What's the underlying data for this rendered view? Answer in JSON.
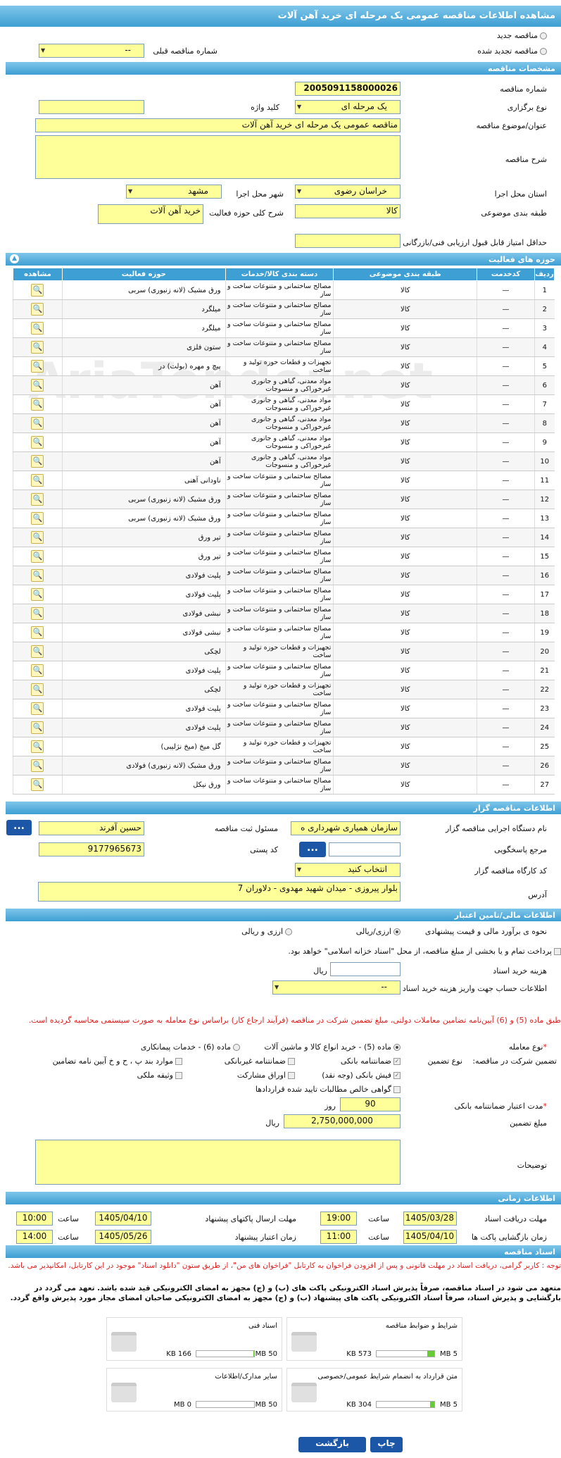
{
  "title": "مشاهده اطلاعات مناقصه عمومی یک مرحله ای خرید آهن آلات",
  "new_label": "مناقصه جدید",
  "renew_label": "مناقصه تجدید شده",
  "prev_label": "شماره مناقصه قبلی",
  "prev_value": "--",
  "sec_spec": "مشخصات مناقصه",
  "num_label": "شماره مناقصه",
  "num_value": "2005091158000026",
  "type_label": "نوع برگزاری",
  "type_value": "یک مرحله ای",
  "kw_label": "کلید واژه",
  "subj_label": "عنوان/موضوع مناقصه",
  "subj_value": "مناقصه عمومی یک مرحله ای خرید آهن آلات",
  "desc_label": "شرح مناقصه",
  "prov_label": "استان محل اجرا",
  "prov_value": "خراسان رضوی",
  "city_label": "شهر محل اجرا",
  "city_value": "مشهد",
  "cat_label": "طبقه بندی موضوعی",
  "cat_value": "کالا",
  "scope_label": "شرح کلی حوزه فعالیت",
  "scope_value": "خرید آهن آلات",
  "min_label": "حداقل امتیاز قابل قبول ارزیابی فنی/بازرگانی",
  "sec_fields": "حوزه های فعالیت",
  "cols": [
    "ردیف",
    "کدخدمت",
    "طبقه بندی موضوعی",
    "دسته بندی کالا/خدمات",
    "حوزه فعالیت",
    "مشاهده"
  ],
  "rows": [
    [
      "1",
      "—",
      "کالا",
      "مصالح ساختمانی و متنوعات ساخت و ساز",
      "ورق مشبک (لانه زنبوری) سربی"
    ],
    [
      "2",
      "—",
      "کالا",
      "مصالح ساختمانی و متنوعات ساخت و ساز",
      "میلگرد"
    ],
    [
      "3",
      "—",
      "کالا",
      "مصالح ساختمانی و متنوعات ساخت و ساز",
      "میلگرد"
    ],
    [
      "4",
      "—",
      "کالا",
      "مصالح ساختمانی و متنوعات ساخت و ساز",
      "ستون فلزی"
    ],
    [
      "5",
      "—",
      "کالا",
      "تجهیزات و قطعات حوزه تولید و ساخت",
      "پیچ و مهره (بولت) در"
    ],
    [
      "6",
      "—",
      "کالا",
      "مواد معدنی، گیاهی و جانوری غیرخوراکی و منسوجات",
      "آهن"
    ],
    [
      "7",
      "—",
      "کالا",
      "مواد معدنی، گیاهی و جانوری غیرخوراکی و منسوجات",
      "آهن"
    ],
    [
      "8",
      "—",
      "کالا",
      "مواد معدنی، گیاهی و جانوری غیرخوراکی و منسوجات",
      "آهن"
    ],
    [
      "9",
      "—",
      "کالا",
      "مواد معدنی، گیاهی و جانوری غیرخوراکی و منسوجات",
      "آهن"
    ],
    [
      "10",
      "—",
      "کالا",
      "مواد معدنی، گیاهی و جانوری غیرخوراکی و منسوجات",
      "آهن"
    ],
    [
      "11",
      "—",
      "کالا",
      "مصالح ساختمانی و متنوعات ساخت و ساز",
      "ناودانی آهنی"
    ],
    [
      "12",
      "—",
      "کالا",
      "مصالح ساختمانی و متنوعات ساخت و ساز",
      "ورق مشبک (لانه زنبوری) سربی"
    ],
    [
      "13",
      "—",
      "کالا",
      "مصالح ساختمانی و متنوعات ساخت و ساز",
      "ورق مشبک (لانه زنبوری) سربی"
    ],
    [
      "14",
      "—",
      "کالا",
      "مصالح ساختمانی و متنوعات ساخت و ساز",
      "تیر ورق"
    ],
    [
      "15",
      "—",
      "کالا",
      "مصالح ساختمانی و متنوعات ساخت و ساز",
      "تیر ورق"
    ],
    [
      "16",
      "—",
      "کالا",
      "مصالح ساختمانی و متنوعات ساخت و ساز",
      "پلیت فولادی"
    ],
    [
      "17",
      "—",
      "کالا",
      "مصالح ساختمانی و متنوعات ساخت و ساز",
      "پلیت فولادی"
    ],
    [
      "18",
      "—",
      "کالا",
      "مصالح ساختمانی و متنوعات ساخت و ساز",
      "نبشی فولادی"
    ],
    [
      "19",
      "—",
      "کالا",
      "مصالح ساختمانی و متنوعات ساخت و ساز",
      "نبشی فولادی"
    ],
    [
      "20",
      "—",
      "کالا",
      "تجهیزات و قطعات حوزه تولید و ساخت",
      "لچکی"
    ],
    [
      "21",
      "—",
      "کالا",
      "مصالح ساختمانی و متنوعات ساخت و ساز",
      "پلیت فولادی"
    ],
    [
      "22",
      "—",
      "کالا",
      "تجهیزات و قطعات حوزه تولید و ساخت",
      "لچکی"
    ],
    [
      "23",
      "—",
      "کالا",
      "مصالح ساختمانی و متنوعات ساخت و ساز",
      "پلیت فولادی"
    ],
    [
      "24",
      "—",
      "کالا",
      "مصالح ساختمانی و متنوعات ساخت و ساز",
      "پلیت فولادی"
    ],
    [
      "25",
      "—",
      "کالا",
      "تجهیزات و قطعات حوزه تولید و ساخت",
      "گل میخ (میخ نژلیبی)"
    ],
    [
      "26",
      "—",
      "کالا",
      "مصالح ساختمانی و متنوعات ساخت و ساز",
      "ورق مشبک (لانه زنبوری) فولادی"
    ],
    [
      "27",
      "—",
      "کالا",
      "مصالح ساختمانی و متنوعات ساخت و ساز",
      "ورق نیکل"
    ]
  ],
  "sec_org": "اطلاعات مناقصه گزار",
  "org_label": "نام دستگاه اجرایی مناقصه گزار",
  "org_value": "سازمان همیاری شهرداری ه",
  "resp_label": "مسئول ثبت مناقصه",
  "resp_value": "حسین آفرند",
  "ref_label": "مرجع پاسخگویی",
  "postal_label": "کد پستی",
  "postal_value": "9177965673",
  "ws_label": "کد کارگاه مناقصه گزار",
  "ws_value": "انتخاب کنید",
  "addr_label": "آدرس",
  "addr_value": "بلوار پیروزی - میدان شهید مهدوی - دلاوران 7",
  "btn_dots": "...",
  "sec_fin": "اطلاعات مالی/تامین اعتبار",
  "est_label": "نحوه ی برآورد مالی و قیمت پیشنهادی",
  "est_opt1": "ارزی/ریالی",
  "est_opt2": "ارزی و ریالی",
  "pay_label": "پرداخت تمام و یا بخشی از مبلغ مناقصه، از محل \"اسناد خزانه اسلامی\" خواهد بود.",
  "cost_label": "هزینه خرید اسناد",
  "cost_unit": "ریال",
  "acc_label": "اطلاعات حساب جهت واریز هزینه خرید اسناد",
  "acc_value": "--",
  "law_note": "طبق ماده (5) و (6) آیین‌نامه تضامین معاملات دولتی، مبلغ تضمین شرکت در مناقصه (فرآیند ارجاع کار) براساس نوع معامله به صورت سیستمی محاسبه گردیده است.",
  "deal_label": "نوع معامله",
  "deal_opt1": "ماده (5) - خرید انواع کالا و ماشین آلات",
  "deal_opt2": "ماده (6) - خدمات پیمانکاری",
  "guar_label": "تضمین شرکت در مناقصه:",
  "guar_type": "نوع تضمین",
  "g1": "ضمانتنامه بانکی",
  "g2": "ضمانتنامه غیربانکی",
  "g3": "موارد بند پ ، ح و خ آیین نامه تضامین",
  "g4": "فیش بانکی (وجه نقد)",
  "g5": "اوراق مشارکت",
  "g6": "وثیقه ملکی",
  "g7": "گواهی خالص مطالبات تایید شده قراردادها",
  "valid_label": "مدت اعتبار ضمانتنامه بانکی",
  "valid_value": "90",
  "valid_unit": "روز",
  "amount_label": "مبلغ تضمین",
  "amount_value": "2,750,000,000",
  "amount_unit": "ریال",
  "notes_label": "توضیحات",
  "sec_time": "اطلاعات زمانی",
  "t1_label": "مهلت دریافت اسناد",
  "t1_date": "1405/03/28",
  "t1_time": "19:00",
  "t2_label": "مهلت ارسال پاکتهای پیشنهاد",
  "t2_date": "1405/04/10",
  "t2_time": "10:00",
  "t3_label": "زمان بازگشایی پاکت ها",
  "t3_date": "1405/04/10",
  "t3_time": "11:00",
  "t4_label": "زمان اعتبار پیشنهاد",
  "t4_date": "1405/05/26",
  "t4_time": "14:00",
  "time_word": "ساعت",
  "sec_docs": "اسناد مناقصه",
  "docs_note1": "توجه : کاربر گرامی، دریافت اسناد در مهلت قانونی و پس از افزودن فراخوان به کارتابل \"فراخوان های من\"، از طریق ستون \"دانلود اسناد\" موجود در این کارتابل، امکانپذیر می باشد.",
  "docs_note2": "متعهد می شود در اسناد مناقصه، صرفاً پذیرش اسناد الکترونیکی پاکت های (ب) و (ج) مجهز به امضای الکترونیکی قید شده باشد. تعهد می گردد در بارگشایی و پذیرش اسناد، صرفاً اسناد الکترونیکی پاکت های پیشنهاد (ب) و (ج) مجهز به امضای الکترونیکی صاحبان امضای مجاز مورد پذیرش واقع گردد.",
  "d1": "شرایط و ضوابط مناقصه",
  "d1a": "573 KB",
  "d1b": "5 MB",
  "d1p": 0.12,
  "d2": "اسناد فنی",
  "d2a": "166 KB",
  "d2b": "50 MB",
  "d2p": 0.01,
  "d3": "متن قرارداد به انضمام شرایط عمومی/خصوصی",
  "d3a": "304 KB",
  "d3b": "5 MB",
  "d3p": 0.07,
  "d4": "سایر مدارک/اطلاعات",
  "d4a": "0 MB",
  "d4b": "50 MB",
  "d4p": 0,
  "print_btn": "چاپ",
  "back_btn": "بازگشت",
  "watermark": "AriaTender.net"
}
